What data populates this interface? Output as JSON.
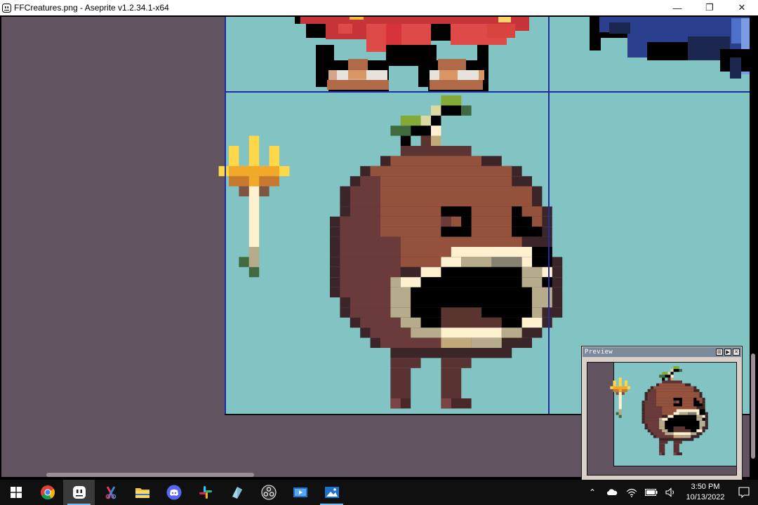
{
  "window": {
    "title": "FFCreatures.png - Aseprite v1.2.34.1-x64",
    "minimize_glyph": "—",
    "restore_glyph": "❐",
    "close_glyph": "✕"
  },
  "preview": {
    "title": "Preview",
    "buttons": [
      "⊞",
      "▶",
      "✕"
    ]
  },
  "taskbar": {
    "apps": [
      {
        "name": "windows-start",
        "active": false
      },
      {
        "name": "chrome",
        "active": false
      },
      {
        "name": "aseprite",
        "active": true
      },
      {
        "name": "snip-sketch",
        "active": false
      },
      {
        "name": "file-explorer",
        "active": false
      },
      {
        "name": "discord",
        "active": false
      },
      {
        "name": "slack",
        "active": false
      },
      {
        "name": "typora",
        "active": false
      },
      {
        "name": "obs-studio",
        "active": false
      },
      {
        "name": "movies-tv",
        "active": false
      },
      {
        "name": "photos",
        "active": true
      }
    ],
    "tray": {
      "chevron": "⌃",
      "time": "3:50 PM",
      "date": "10/13/2022"
    }
  },
  "colors": {
    "sprite_bg": "#82c3c3",
    "grid_line": "#1a2fd0",
    "workspace_bg": "#625360",
    "accent": "#76b9ed"
  }
}
